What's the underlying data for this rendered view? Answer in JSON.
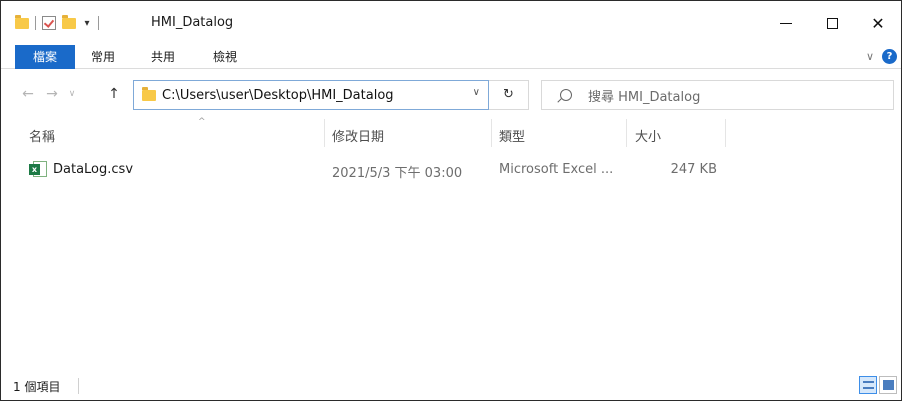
{
  "titlebar": {
    "title": "HMI_Datalog",
    "qat_dropdown": "▾",
    "minimize": "—",
    "maximize": "☐",
    "close": "✕"
  },
  "ribbon": {
    "tabs": [
      "檔案",
      "常用",
      "共用",
      "檢視"
    ],
    "expand": "∨",
    "help": "?"
  },
  "nav": {
    "back": "←",
    "forward": "→",
    "recent": "∨",
    "up": "↑",
    "address": "C:\\Users\\user\\Desktop\\HMI_Datalog",
    "address_dropdown": "∨",
    "refresh": "↻",
    "search_placeholder": "搜尋 HMI_Datalog"
  },
  "columns": {
    "name": "名稱",
    "modified": "修改日期",
    "type": "類型",
    "size": "大小",
    "sort_indicator": "^"
  },
  "files": [
    {
      "name": "DataLog.csv",
      "modified": "2021/5/3 下午 03:00",
      "type": "Microsoft Excel ...",
      "size": "247 KB",
      "icon": "excel-csv-icon"
    }
  ],
  "status": {
    "item_count": "1 個項目"
  },
  "colors": {
    "accent": "#1a6ac9",
    "folder": "#f8c948",
    "excel": "#1d7a45"
  }
}
